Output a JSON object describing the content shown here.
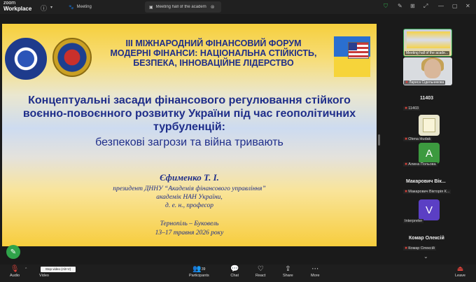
{
  "app": {
    "logo_line1": "zoom",
    "logo_line2": "Workplace"
  },
  "tabs": [
    {
      "label": "Meeting",
      "active": false
    },
    {
      "label": "Meeting hall of the academ",
      "active": true
    }
  ],
  "slide": {
    "forum_title_1": "ІІІ МІЖНАРОДНИЙ ФІНАНСОВИЙ ФОРУМ",
    "forum_title_2": "МОДЕРНІ ФІНАНСИ: НАЦІОНАЛЬНА СТІЙКІСТЬ,",
    "forum_title_3": "БЕЗПЕКА, ІННОВАЦІЙНЕ ЛІДЕРСТВО",
    "main_title_1": "Концептуальні засади фінансового регулювання стійкого",
    "main_title_2": "воєнно-повоєнного розвитку України під час геополітичних",
    "main_title_3": "турбуленцій:",
    "subtitle": "безпекові загрози та війна тривають",
    "author": "Єфименко Т. І.",
    "author_info_1": "президент ДННУ “Академія фінансового управління”",
    "author_info_2": "академік НАН України,",
    "author_info_3": "д. е. н., професор",
    "place": "Тернопіль – Буковель",
    "date": "13–17 травня 2026 року"
  },
  "panel": {
    "thumb1_label": "Meeting hall of the acade...",
    "thumb2_label": "Лариса Сідельникова",
    "count_title": "11403",
    "count_label": "11403",
    "p1_label": "Olena Hudak",
    "p2_label": "Алина Польова",
    "p2_initial": "A",
    "p3_name": "Макарович  Вік...",
    "p3_label": "Макарович Вікторія К...",
    "p4_label": "Interpreter",
    "p4_initial": "V",
    "p5_name": "Комар Олексій",
    "p5_label": "Комар Олексій"
  },
  "toolbar": {
    "audio": "Audio",
    "video": "Video",
    "video_tooltip": "Stop video (Alt+V)",
    "participants": "Participants",
    "participants_count": "39",
    "chat": "Chat",
    "react": "React",
    "share": "Share",
    "more": "More",
    "leave": "Leave"
  },
  "icons": {
    "audio": "muted-mic-icon",
    "video": "video-camera-icon",
    "participants": "people-icon",
    "chat": "chat-bubble-icon",
    "react": "heart-icon",
    "share": "share-arrow-icon",
    "more": "ellipsis-icon",
    "leave": "leave-icon"
  },
  "colors": {
    "accent_green": "#2fa34a",
    "slide_text": "#1f2e8a",
    "leave_red": "#e0423a"
  }
}
